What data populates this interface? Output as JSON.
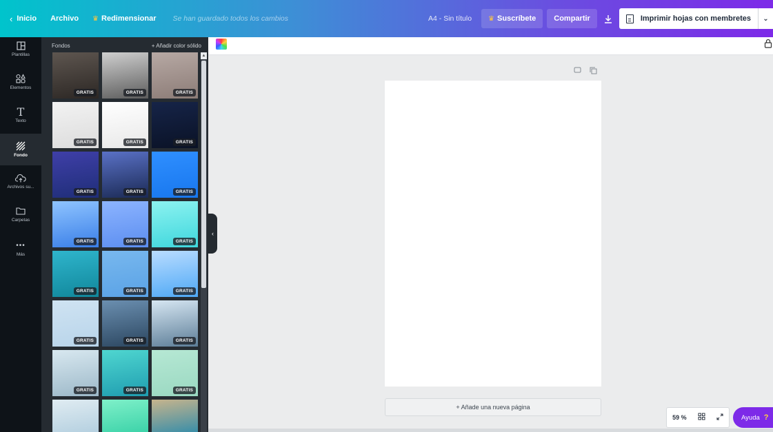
{
  "topbar": {
    "home": "Inicio",
    "file": "Archivo",
    "resize": "Redimensionar",
    "saved_status": "Se han guardado todos los cambios",
    "doc_title": "A4 - Sin título",
    "subscribe": "Suscríbete",
    "share": "Compartir",
    "print": "Imprimir hojas con membretes"
  },
  "rail": [
    {
      "label": "Plantillas",
      "icon": "template-icon"
    },
    {
      "label": "Elementos",
      "icon": "shapes-icon"
    },
    {
      "label": "Texto",
      "icon": "text-icon"
    },
    {
      "label": "Fondo",
      "icon": "background-icon"
    },
    {
      "label": "Archivos su...",
      "icon": "cloud-upload-icon"
    },
    {
      "label": "Carpetas",
      "icon": "folder-icon"
    },
    {
      "label": "Más",
      "icon": "more-icon"
    }
  ],
  "panel": {
    "title": "Fondos",
    "add_solid": "+ Añadir color sólido",
    "badge": "GRATIS",
    "backgrounds": [
      {
        "name": "dark-gradient",
        "colors": [
          "#5e5650",
          "#2c2724"
        ]
      },
      {
        "name": "smoke",
        "colors": [
          "#cfcfcf",
          "#5d5d5d"
        ]
      },
      {
        "name": "wood-planks",
        "colors": [
          "#b7a9a4",
          "#8c7c77"
        ]
      },
      {
        "name": "marble",
        "colors": [
          "#f2f2f2",
          "#dcdcdc"
        ]
      },
      {
        "name": "transparent-grid",
        "colors": [
          "#ffffff",
          "#e8e8e8"
        ]
      },
      {
        "name": "starry-night",
        "colors": [
          "#162448",
          "#0a1226"
        ]
      },
      {
        "name": "blue-purple-gradient",
        "colors": [
          "#3f3fa8",
          "#1f2e78"
        ]
      },
      {
        "name": "night-sky-mountains",
        "colors": [
          "#5a71c6",
          "#1b2a55"
        ]
      },
      {
        "name": "blue-hexagons",
        "colors": [
          "#2f8fff",
          "#1877ee"
        ]
      },
      {
        "name": "sky-blue-gradient",
        "colors": [
          "#8fc4ff",
          "#3a7fe8"
        ]
      },
      {
        "name": "blue-dandelion",
        "colors": [
          "#8cb4ff",
          "#5c8ef0"
        ]
      },
      {
        "name": "aqua-gradient",
        "colors": [
          "#8cf2f0",
          "#3fd7dd"
        ]
      },
      {
        "name": "sea-water",
        "colors": [
          "#2fb5cc",
          "#11879b"
        ]
      },
      {
        "name": "blue-diamond-pattern",
        "colors": [
          "#78b8ee",
          "#5aa2e6"
        ]
      },
      {
        "name": "light-blue-gradient",
        "colors": [
          "#b9dcff",
          "#4fa9f6"
        ]
      },
      {
        "name": "pale-pattern",
        "colors": [
          "#cfe3f2",
          "#b8d4ea"
        ]
      },
      {
        "name": "raindrops-glass",
        "colors": [
          "#6b8fb0",
          "#2b4660"
        ]
      },
      {
        "name": "misty-mountains",
        "colors": [
          "#d6e6f2",
          "#5d7e98"
        ]
      },
      {
        "name": "foggy-lake",
        "colors": [
          "#d8e8f0",
          "#9cb8c8"
        ]
      },
      {
        "name": "turquoise-water",
        "colors": [
          "#4fd6d0",
          "#1f9db0"
        ]
      },
      {
        "name": "mint-pattern",
        "colors": [
          "#b6e8d4",
          "#9ad8c1"
        ]
      },
      {
        "name": "beach-waves",
        "colors": [
          "#e0ecf2",
          "#b5d0e0"
        ]
      },
      {
        "name": "mint-gradient",
        "colors": [
          "#7ff0c9",
          "#3dd3a9"
        ]
      },
      {
        "name": "aerial-beach",
        "colors": [
          "#c7b48c",
          "#3a8ea8"
        ]
      }
    ]
  },
  "editor": {
    "add_page": "+ Añade una nueva página",
    "zoom": "59 %",
    "help": "Ayuda",
    "help_q": "?"
  },
  "colors": {
    "accent": "#7d2ae8",
    "rail_bg": "#0e1318",
    "panel_bg": "#252b31",
    "canvas_bg": "#ebeced",
    "crown": "#ffc83d"
  }
}
